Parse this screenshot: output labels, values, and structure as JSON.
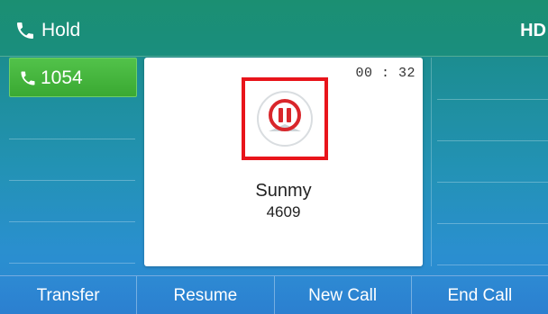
{
  "status_bar": {
    "status_label": "Hold",
    "hd_label": "HD",
    "icon": "phone-handset-icon"
  },
  "line_keys": [
    {
      "label": "1054",
      "icon": "phone-handset-icon",
      "active": true
    },
    {
      "label": ""
    },
    {
      "label": ""
    },
    {
      "label": ""
    },
    {
      "label": ""
    }
  ],
  "call": {
    "timer": "00 : 32",
    "caller_name": "Sunmy",
    "caller_number": "4609",
    "hold_icon": "pause-circle-icon"
  },
  "softkeys": [
    {
      "label": "Transfer"
    },
    {
      "label": "Resume"
    },
    {
      "label": "New Call"
    },
    {
      "label": "End Call"
    }
  ],
  "colors": {
    "highlight_border": "#e8141b",
    "active_line_key": "#3aa932",
    "hold_icon": "#d9262b"
  }
}
